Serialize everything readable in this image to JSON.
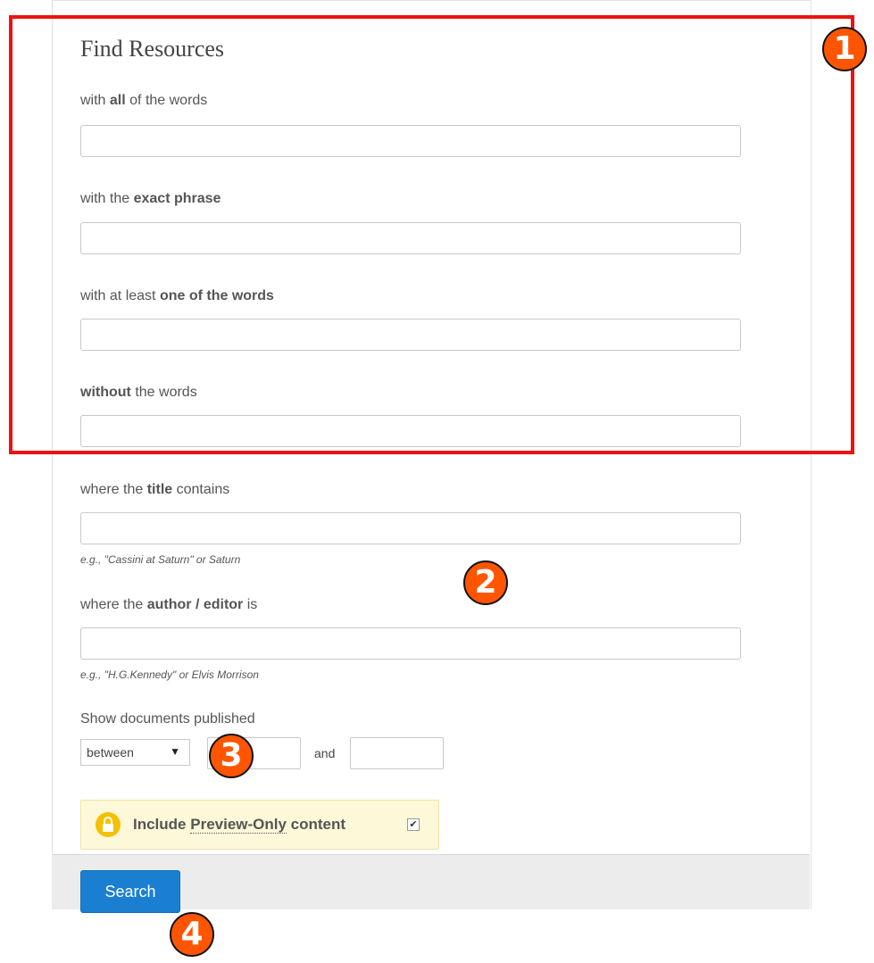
{
  "page": {
    "title": "Find Resources"
  },
  "fields": {
    "all_words": {
      "pre": "with ",
      "bold": "all",
      "post": " of the words"
    },
    "exact_phrase": {
      "pre": "with the ",
      "bold": "exact phrase",
      "post": ""
    },
    "one_of": {
      "pre": "with at least ",
      "bold": "one of the words",
      "post": ""
    },
    "without": {
      "pre": "",
      "bold": "without",
      "post": " the words"
    },
    "title": {
      "pre": "where the ",
      "bold": "title",
      "post": " contains",
      "hint": "e.g., \"Cassini at Saturn\" or Saturn"
    },
    "author": {
      "pre": "where the ",
      "bold": "author / editor",
      "post": " is",
      "hint": "e.g., \"H.G.Kennedy\" or Elvis Morrison"
    }
  },
  "date_filter": {
    "label": "Show documents published",
    "selected": "between",
    "arrow": "▼",
    "and_label": "and"
  },
  "preview": {
    "pre": "Include ",
    "link": "Preview-Only",
    "post": " content",
    "checked": true,
    "check_mark": "✔",
    "icon": "lock-icon"
  },
  "footer": {
    "search_label": "Search"
  },
  "annotations": {
    "markers": [
      "1",
      "2",
      "3",
      "4"
    ],
    "highlight_color": "#ee1111",
    "marker_color": "#ff5500"
  }
}
